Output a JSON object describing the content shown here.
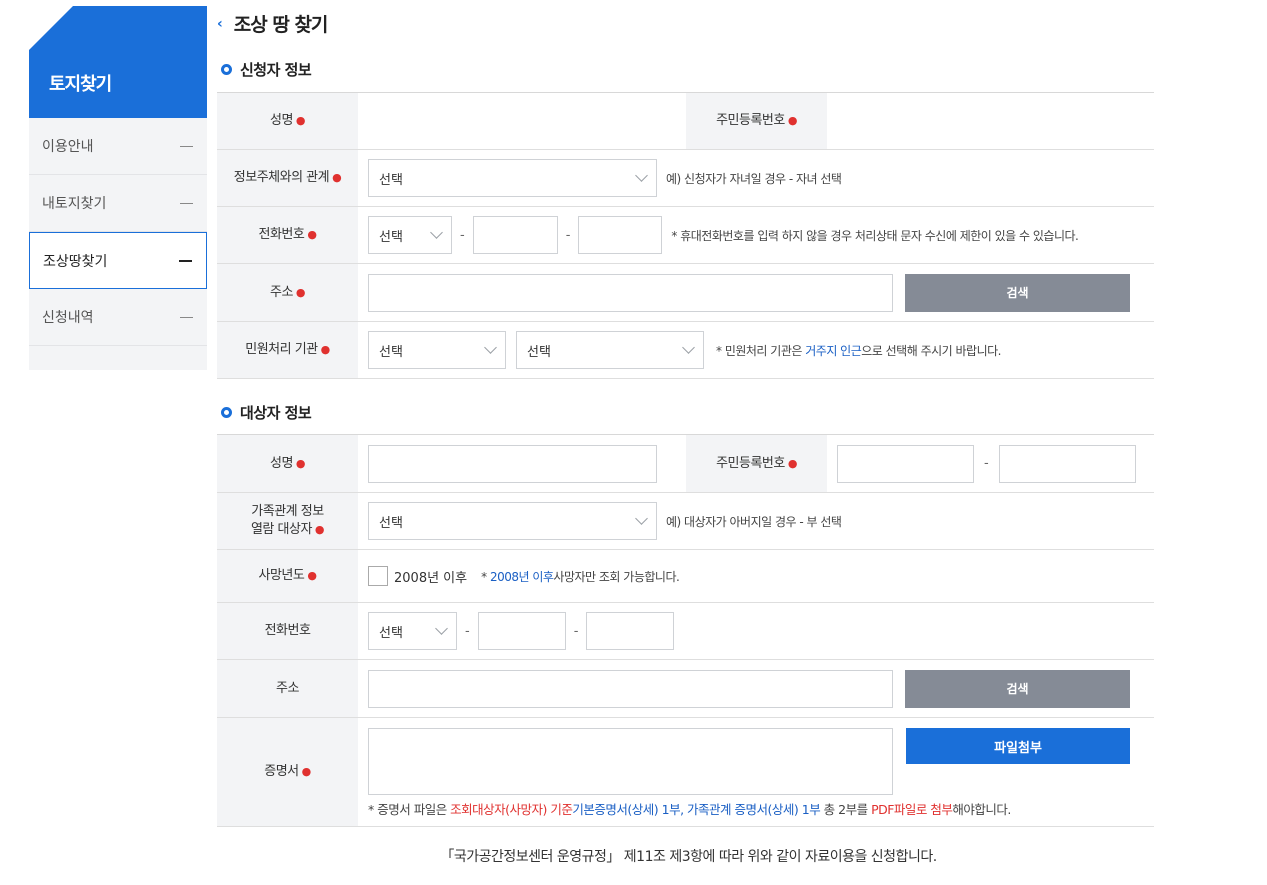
{
  "sidebar": {
    "title": "토지찾기",
    "items": [
      {
        "label": "이용안내"
      },
      {
        "label": "내토지찾기"
      },
      {
        "label": "조상땅찾기"
      },
      {
        "label": "신청내역"
      }
    ]
  },
  "page": {
    "title": "조상 땅 찾기"
  },
  "applicant": {
    "section_title": "신청자 정보",
    "name_label": "성명",
    "rrn_label": "주민등록번호",
    "relation_label": "정보주체와의 관계",
    "relation_select": "선택",
    "relation_hint": "예) 신청자가 자녀일 경우 - 자녀 선택",
    "phone_label": "전화번호",
    "phone_select": "선택",
    "phone_hint": "* 휴대전화번호를 입력 하지 않을 경우 처리상태 문자 수신에 제한이 있을 수 있습니다.",
    "address_label": "주소",
    "search_button": "검색",
    "office_label": "민원처리 기관",
    "office_select1": "선택",
    "office_select2": "선택",
    "office_hint_pre": "* 민원처리 기관은 ",
    "office_hint_blue": "거주지 인근",
    "office_hint_post": "으로 선택해 주시기 바랍니다."
  },
  "target": {
    "section_title": "대상자 정보",
    "name_label": "성명",
    "rrn_label": "주민등록번호",
    "family_label_1": "가족관계 정보",
    "family_label_2": "열람 대상자",
    "family_select": "선택",
    "family_hint": "예) 대상자가 아버지일 경우 - 부 선택",
    "death_label": "사망년도",
    "death_check_label": "2008년 이후",
    "death_hint_pre": "* ",
    "death_hint_blue": "2008년 이후",
    "death_hint_post": "사망자만 조회 가능합니다.",
    "phone_label": "전화번호",
    "phone_select": "선택",
    "address_label": "주소",
    "search_button": "검색",
    "cert_label": "증명서",
    "attach_button": "파일첨부",
    "cert_hint_1": "* 증명서 파일은 ",
    "cert_hint_red1": "조회대상자(사망자) 기준",
    "cert_hint_blue1": "기본증명서(상세) 1부",
    "cert_hint_comma": ", ",
    "cert_hint_blue2": "가족관계 증명서(상세) 1부",
    "cert_hint_mid": " 총 2부를 ",
    "cert_hint_red2": "PDF파일로 첨부",
    "cert_hint_end": "해야합니다."
  },
  "footer": {
    "note": "「국가공간정보센터 운영규정」 제11조 제3항에 따라 위와 같이 자료이용을 신청합니다."
  },
  "colors": {
    "accent": "#1a6fd9",
    "required": "#e0312f",
    "button_gray": "#858b96"
  }
}
